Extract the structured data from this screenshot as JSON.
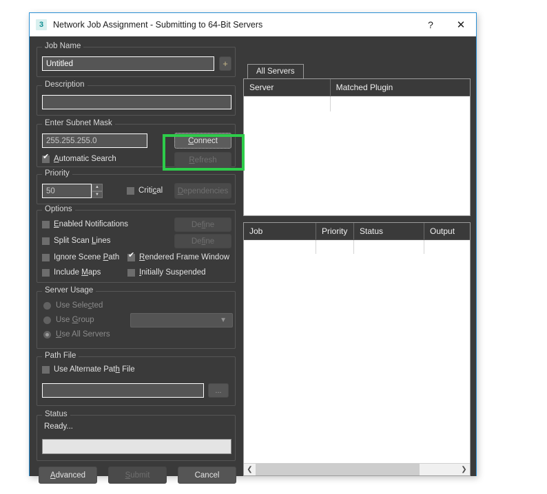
{
  "window": {
    "title": "Network Job Assignment - Submitting to 64-Bit Servers",
    "app_icon_glyph": "3",
    "help_label": "?",
    "close_label": "✕",
    "accent_border": "#2a8fd4"
  },
  "highlight": {
    "color": "#2ecc4a",
    "target": "connect-button"
  },
  "left": {
    "job_name": {
      "legend": "Job Name",
      "value": "Untitled",
      "add_label": "+"
    },
    "description": {
      "legend": "Description",
      "value": ""
    },
    "subnet": {
      "legend": "Enter Subnet Mask",
      "value": "255.255.255.0",
      "connect_label": "Connect",
      "refresh_label": "Refresh",
      "automatic_search_label": "Automatic Search",
      "automatic_search_checked": true
    },
    "priority": {
      "legend": "Priority",
      "value": "50",
      "critical_label": "Critical",
      "critical_checked": false,
      "dependencies_label": "Dependencies"
    },
    "options": {
      "legend": "Options",
      "items": [
        {
          "label": "Enabled Notifications",
          "checked": false
        },
        {
          "label": "Split Scan Lines",
          "checked": false
        },
        {
          "label": "Ignore Scene Path",
          "checked": false
        },
        {
          "label": "Rendered Frame Window",
          "checked": true
        },
        {
          "label": "Include Maps",
          "checked": false
        },
        {
          "label": "Initially Suspended",
          "checked": false
        }
      ],
      "define_1_label": "Define",
      "define_2_label": "Define"
    },
    "server_usage": {
      "legend": "Server Usage",
      "radios": [
        {
          "label": "Use Selected",
          "selected": false
        },
        {
          "label": "Use Group",
          "selected": false
        },
        {
          "label": "Use All Servers",
          "selected": true
        }
      ],
      "group_combo_value": ""
    },
    "path_file": {
      "legend": "Path File",
      "use_alternate_label": "Use Alternate Path File",
      "use_alternate_checked": false,
      "path_value": "",
      "browse_label": "..."
    },
    "status": {
      "legend": "Status",
      "message": "Ready...",
      "progress_percent": 0
    },
    "buttons": {
      "advanced_label": "Advanced",
      "submit_label": "Submit",
      "submit_disabled": true,
      "cancel_label": "Cancel"
    }
  },
  "right": {
    "servers_panel": {
      "tab_label": "All Servers",
      "columns": [
        "Server",
        "Matched Plugin"
      ],
      "rows": []
    },
    "jobs_panel": {
      "columns": [
        "Job",
        "Priority",
        "Status",
        "Output"
      ],
      "rows": [],
      "scroll_left_glyph": "❮",
      "scroll_right_glyph": "❯"
    }
  }
}
